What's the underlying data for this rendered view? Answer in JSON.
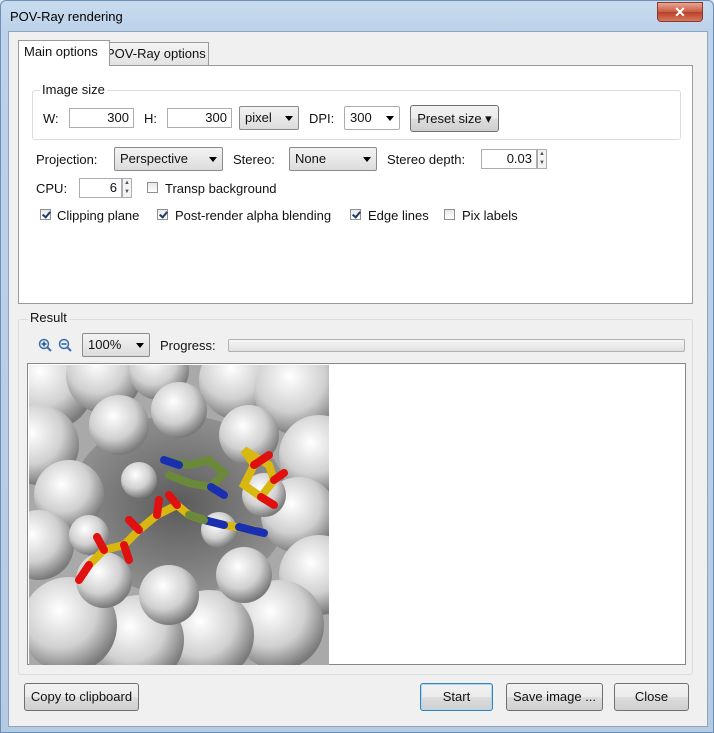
{
  "window": {
    "title": "POV-Ray rendering",
    "close_glyph": "✕"
  },
  "tabs": [
    {
      "label": "Main options"
    },
    {
      "label": "POV-Ray options"
    }
  ],
  "image_size": {
    "group_label": "Image size",
    "w_label": "W:",
    "w_value": "300",
    "h_label": "H:",
    "h_value": "300",
    "unit": "pixel",
    "dpi_label": "DPI:",
    "dpi_value": "300",
    "preset_label": "Preset size ▾"
  },
  "projection": {
    "label": "Projection:",
    "value": "Perspective"
  },
  "stereo": {
    "label": "Stereo:",
    "value": "None"
  },
  "stereo_depth": {
    "label": "Stereo depth:",
    "value": "0.03"
  },
  "cpu": {
    "label": "CPU:",
    "value": "6"
  },
  "checkboxes": {
    "transp_background": {
      "label": "Transp background",
      "checked": false
    },
    "clipping_plane": {
      "label": "Clipping plane",
      "checked": true
    },
    "alpha_blending": {
      "label": "Post-render alpha blending",
      "checked": true
    },
    "edge_lines": {
      "label": "Edge lines",
      "checked": true
    },
    "pix_labels": {
      "label": "Pix labels",
      "checked": false
    }
  },
  "result": {
    "group_label": "Result",
    "zoom_value": "100%",
    "progress_label": "Progress:",
    "progress_fraction": 0
  },
  "buttons": {
    "copy": "Copy to clipboard",
    "start": "Start",
    "save": "Save image ...",
    "close": "Close"
  },
  "icons": [
    "zoom-in-icon",
    "zoom-out-icon",
    "dropdown-arrow-icon",
    "window-close-icon"
  ]
}
